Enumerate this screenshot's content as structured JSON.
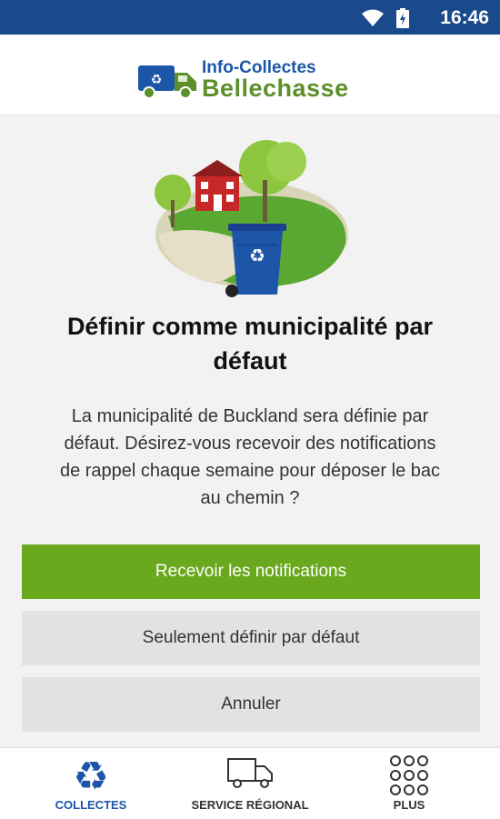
{
  "status_bar": {
    "time": "16:46"
  },
  "header": {
    "logo_line1": "Info-Collectes",
    "logo_line2": "Bellechasse"
  },
  "dialog": {
    "title": "Définir comme municipalité par défaut",
    "message": "La municipalité de Buckland sera définie par défaut. Désirez-vous recevoir des notifications de rappel chaque semaine pour déposer le bac au chemin ?",
    "primary_button": "Recevoir les notifications",
    "secondary_button": "Seulement définir par défaut",
    "cancel_button": "Annuler"
  },
  "bottom_nav": {
    "items": [
      {
        "label": "COLLECTES",
        "icon": "recycle-icon",
        "active": true
      },
      {
        "label": "SERVICE RÉGIONAL",
        "icon": "truck-icon",
        "active": false
      },
      {
        "label": "PLUS",
        "icon": "grid-dots-icon",
        "active": false
      }
    ]
  },
  "colors": {
    "status_bar": "#1a4a8c",
    "brand_blue": "#1d56a8",
    "brand_green": "#6aa81e"
  }
}
